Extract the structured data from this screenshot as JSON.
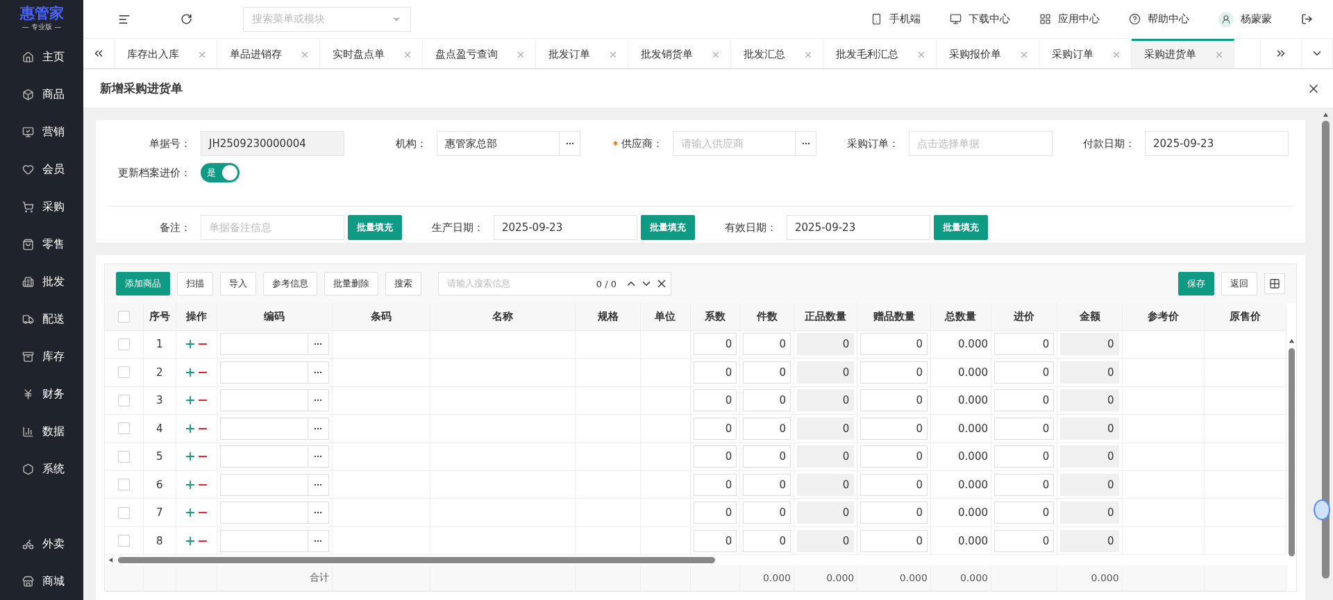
{
  "logo": {
    "name": "惠管家",
    "edition": "— 专业版 —"
  },
  "sidebar": {
    "items": [
      {
        "label": "主页",
        "selected": false
      },
      {
        "label": "商品",
        "selected": false
      },
      {
        "label": "营销",
        "selected": false
      },
      {
        "label": "会员",
        "selected": false
      },
      {
        "label": "采购",
        "selected": false
      },
      {
        "label": "零售",
        "selected": false
      },
      {
        "label": "批发",
        "selected": false
      },
      {
        "label": "配送",
        "selected": false
      },
      {
        "label": "库存",
        "selected": false
      },
      {
        "label": "财务",
        "selected": false
      },
      {
        "label": "数据",
        "selected": false
      },
      {
        "label": "系统",
        "selected": false
      }
    ],
    "bottom_items": [
      {
        "label": "外卖",
        "selected": false
      },
      {
        "label": "商城",
        "selected": false
      }
    ]
  },
  "topbar": {
    "search_placeholder": "搜索菜单或模块",
    "links": [
      "手机端",
      "下载中心",
      "应用中心",
      "帮助中心"
    ],
    "user": "杨蒙蒙"
  },
  "tabs": [
    {
      "label": "库存出入库",
      "selected": false
    },
    {
      "label": "单品进销存",
      "selected": false
    },
    {
      "label": "实时盘点单",
      "selected": false
    },
    {
      "label": "盘点盈亏查询",
      "selected": false
    },
    {
      "label": "批发订单",
      "selected": false
    },
    {
      "label": "批发销货单",
      "selected": false
    },
    {
      "label": "批发汇总",
      "selected": false
    },
    {
      "label": "批发毛利汇总",
      "selected": false
    },
    {
      "label": "采购报价单",
      "selected": false
    },
    {
      "label": "采购订单",
      "selected": false
    },
    {
      "label": "采购进货单",
      "selected": true
    }
  ],
  "dialog": {
    "title": "新增采购进货单"
  },
  "form": {
    "fields": [
      {
        "label": "单据号：",
        "value": "JH2509230000004",
        "kind": "readonly",
        "required": false
      },
      {
        "label": "机构：",
        "value": "惠管家总部",
        "kind": "picker",
        "required": false
      },
      {
        "label": "供应商：",
        "placeholder": "请输入供应商",
        "kind": "picker",
        "required": true
      },
      {
        "label": "采购订单：",
        "placeholder": "点击选择单据",
        "kind": "text",
        "required": false
      },
      {
        "label": "付款日期：",
        "value": "2025-09-23",
        "kind": "text",
        "required": false
      }
    ],
    "toggle": {
      "label": "更新档案进价：",
      "on": true,
      "text": "是"
    },
    "batch": [
      {
        "label": "备注：",
        "placeholder": "单据备注信息",
        "button": "批量填充"
      },
      {
        "label": "生产日期：",
        "value": "2025-09-23",
        "button": "批量填充"
      },
      {
        "label": "有效日期：",
        "value": "2025-09-23",
        "button": "批量填充"
      }
    ]
  },
  "toolbar": {
    "buttons": [
      {
        "label": "添加商品",
        "kind": "primary"
      },
      {
        "label": "扫描",
        "kind": "plain"
      },
      {
        "label": "导入",
        "kind": "plain"
      },
      {
        "label": "参考信息",
        "kind": "plain"
      },
      {
        "label": "批量删除",
        "kind": "plain"
      },
      {
        "label": "搜索",
        "kind": "plain"
      }
    ],
    "search_placeholder": "请输入搜索信息",
    "match_count": "0 / 0",
    "right_buttons": [
      {
        "label": "保存",
        "kind": "primary"
      },
      {
        "label": "返回",
        "kind": "plain"
      }
    ]
  },
  "table": {
    "header_checked": false,
    "columns": [
      {
        "label": "序号",
        "kind": "index"
      },
      {
        "label": "操作",
        "kind": "ops"
      },
      {
        "label": "编码",
        "kind": "picker"
      },
      {
        "label": "条码",
        "kind": "text"
      },
      {
        "label": "名称",
        "kind": "text"
      },
      {
        "label": "规格",
        "kind": "text"
      },
      {
        "label": "单位",
        "kind": "text"
      },
      {
        "label": "系数",
        "kind": "input"
      },
      {
        "label": "件数",
        "kind": "input"
      },
      {
        "label": "正品数量",
        "kind": "readonly"
      },
      {
        "label": "赠品数量",
        "kind": "input"
      },
      {
        "label": "总数量",
        "kind": "value"
      },
      {
        "label": "进价",
        "kind": "input"
      },
      {
        "label": "金额",
        "kind": "readonly"
      },
      {
        "label": "参考价",
        "kind": "text"
      },
      {
        "label": "原售价",
        "kind": "text"
      }
    ],
    "rows": [
      {
        "checked": false,
        "no": "1",
        "coef": "0",
        "pieces": "0",
        "good": "0",
        "gift": "0",
        "total": "0.000",
        "price": "0",
        "amount": "0"
      },
      {
        "checked": false,
        "no": "2",
        "coef": "0",
        "pieces": "0",
        "good": "0",
        "gift": "0",
        "total": "0.000",
        "price": "0",
        "amount": "0"
      },
      {
        "checked": false,
        "no": "3",
        "coef": "0",
        "pieces": "0",
        "good": "0",
        "gift": "0",
        "total": "0.000",
        "price": "0",
        "amount": "0"
      },
      {
        "checked": false,
        "no": "4",
        "coef": "0",
        "pieces": "0",
        "good": "0",
        "gift": "0",
        "total": "0.000",
        "price": "0",
        "amount": "0"
      },
      {
        "checked": false,
        "no": "5",
        "coef": "0",
        "pieces": "0",
        "good": "0",
        "gift": "0",
        "total": "0.000",
        "price": "0",
        "amount": "0"
      },
      {
        "checked": false,
        "no": "6",
        "coef": "0",
        "pieces": "0",
        "good": "0",
        "gift": "0",
        "total": "0.000",
        "price": "0",
        "amount": "0"
      },
      {
        "checked": false,
        "no": "7",
        "coef": "0",
        "pieces": "0",
        "good": "0",
        "gift": "0",
        "total": "0.000",
        "price": "0",
        "amount": "0"
      },
      {
        "checked": false,
        "no": "8",
        "coef": "0",
        "pieces": "0",
        "good": "0",
        "gift": "0",
        "total": "0.000",
        "price": "0",
        "amount": "0"
      }
    ],
    "totals": {
      "label": "合计",
      "pieces": "0.000",
      "good": "0.000",
      "gift": "0.000",
      "total": "0.000",
      "amount": "0.000"
    }
  }
}
